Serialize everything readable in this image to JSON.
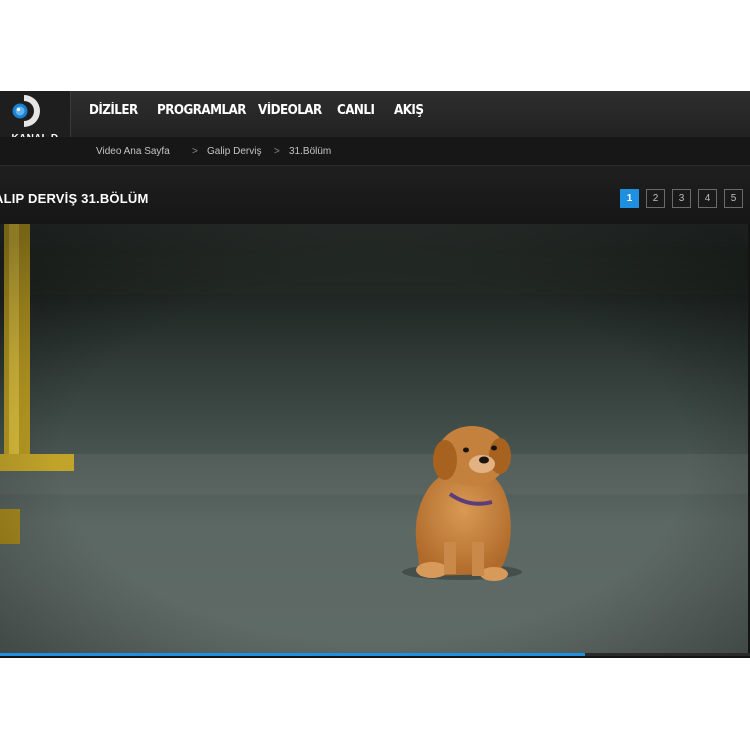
{
  "brand": {
    "logo_text": "KANAL D",
    "accent_color": "#1f8fe0"
  },
  "nav": {
    "items": [
      {
        "label": "DİZİLER"
      },
      {
        "label": "PROGRAMLAR"
      },
      {
        "label": "VİDEOLAR"
      },
      {
        "label": "CANLI"
      },
      {
        "label": "AKIŞ"
      }
    ]
  },
  "breadcrumb": {
    "items": [
      {
        "label": "Video Ana Sayfa"
      },
      {
        "label": "Galip Derviş"
      },
      {
        "label": "31.Bölüm"
      }
    ],
    "separator": ">"
  },
  "video": {
    "title": "ALIP DERVİŞ 31.BÖLÜM",
    "progress_percent": 78
  },
  "pagination": {
    "pages": [
      "1",
      "2",
      "3",
      "4",
      "5"
    ],
    "current": "1"
  }
}
